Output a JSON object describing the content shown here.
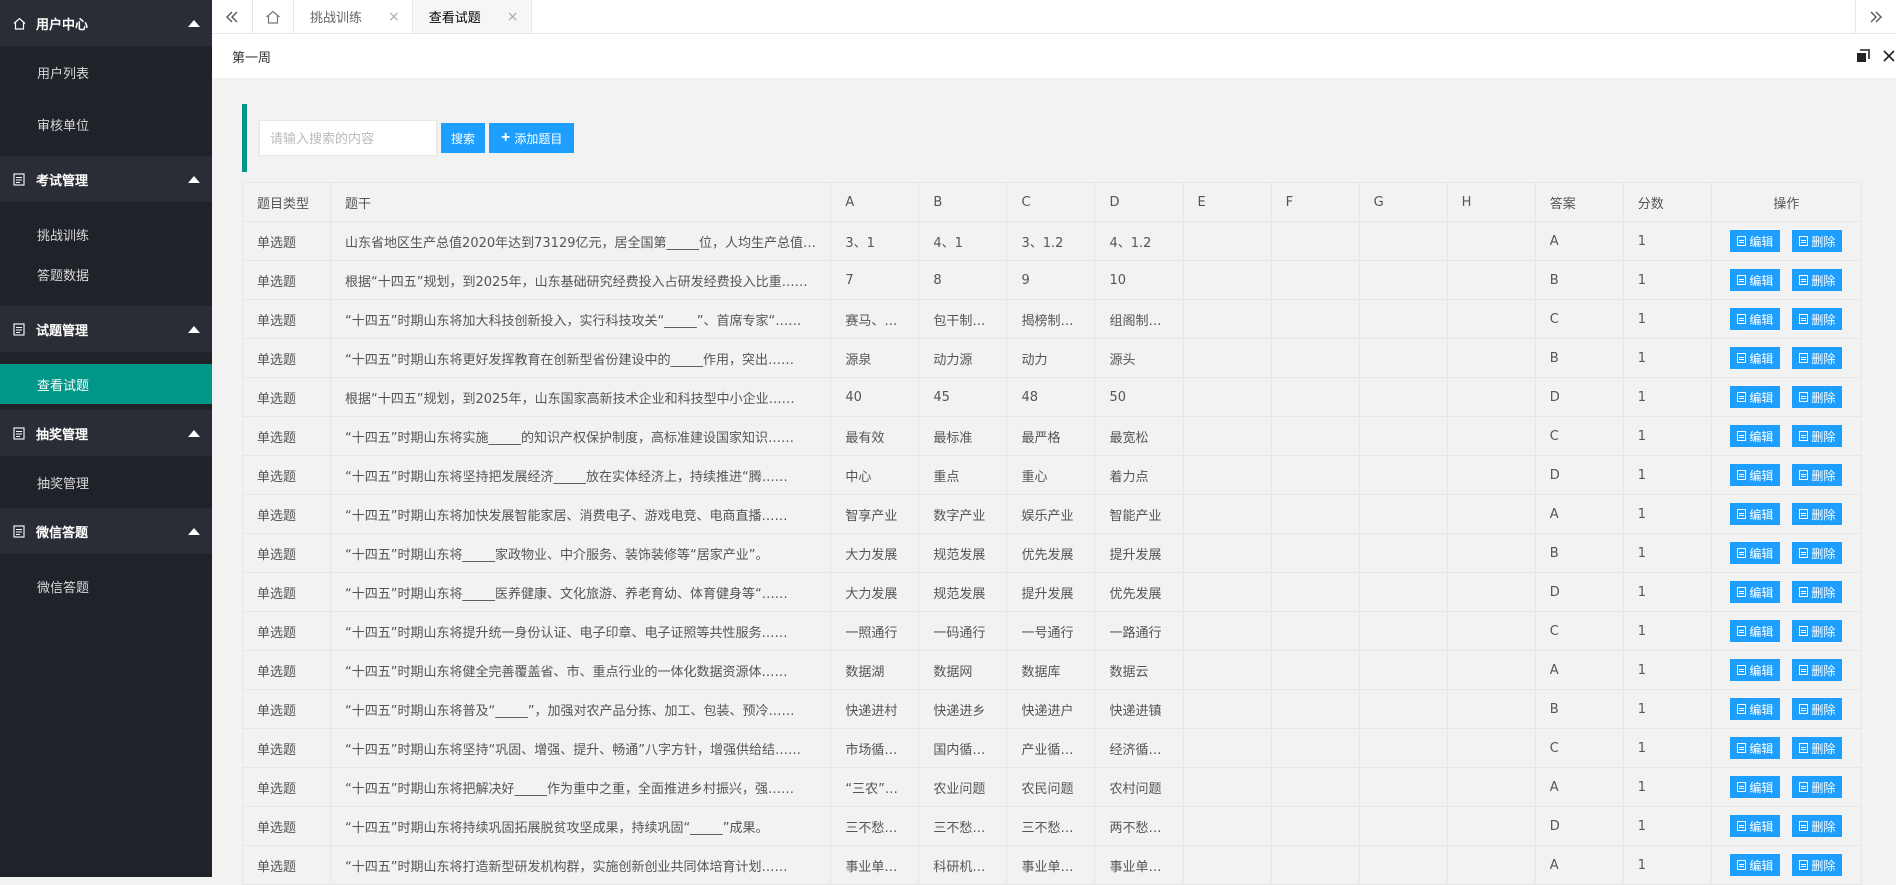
{
  "sidebar": {
    "groups": [
      {
        "title": "用户中心",
        "items": [
          "用户列表",
          "审核单位"
        ]
      },
      {
        "title": "考试管理",
        "items": [
          "挑战训练",
          "答题数据"
        ]
      },
      {
        "title": "试题管理",
        "items": [
          "查看试题"
        ]
      },
      {
        "title": "抽奖管理",
        "items": [
          "抽奖管理"
        ]
      },
      {
        "title": "微信答题",
        "items": [
          "微信答题"
        ]
      }
    ],
    "active_item": "查看试题"
  },
  "tabs": [
    {
      "label": "挑战训练",
      "close": "×"
    },
    {
      "label": "查看试题",
      "close": "×"
    }
  ],
  "breadcrumb": {
    "title": "第一周"
  },
  "search": {
    "placeholder": "请输入搜索的内容",
    "search_label": "搜索",
    "add_label": "添加题目",
    "add_icon": "+"
  },
  "table": {
    "headers": [
      "题目类型",
      "题干",
      "A",
      "B",
      "C",
      "D",
      "E",
      "F",
      "G",
      "H",
      "答案",
      "分数",
      "操作"
    ],
    "edit_label": "编辑",
    "delete_label": "删除",
    "rows": [
      {
        "type": "单选题",
        "stem": "山东省地区生产总值2020年达到73129亿元，居全国第_____位，人均生产总值达到……",
        "a": "3、1",
        "b": "4、1",
        "c": "3、1.2",
        "d": "4、1.2",
        "answer": "A",
        "score": "1"
      },
      {
        "type": "单选题",
        "stem": "根据“十四五”规划，到2025年，山东基础研究经费投入占研发经费投入比重……",
        "a": "7",
        "b": "8",
        "c": "9",
        "d": "10",
        "answer": "B",
        "score": "1"
      },
      {
        "type": "单选题",
        "stem": "“十四五”时期山东将加大科技创新投入，实行科技攻关“_____”、首席专家“……",
        "a": "赛马、…",
        "b": "包干制…",
        "c": "揭榜制…",
        "d": "组阁制…",
        "answer": "C",
        "score": "1"
      },
      {
        "type": "单选题",
        "stem": "“十四五”时期山东将更好发挥教育在创新型省份建设中的_____作用，突出……",
        "a": "源泉",
        "b": "动力源",
        "c": "动力",
        "d": "源头",
        "answer": "B",
        "score": "1"
      },
      {
        "type": "单选题",
        "stem": "根据“十四五”规划，到2025年，山东国家高新技术企业和科技型中小企业……",
        "a": "40",
        "b": "45",
        "c": "48",
        "d": "50",
        "answer": "D",
        "score": "1"
      },
      {
        "type": "单选题",
        "stem": "“十四五”时期山东将实施_____的知识产权保护制度，高标准建设国家知识……",
        "a": "最有效",
        "b": "最标准",
        "c": "最严格",
        "d": "最宽松",
        "answer": "C",
        "score": "1"
      },
      {
        "type": "单选题",
        "stem": "“十四五”时期山东将坚持把发展经济_____放在实体经济上，持续推进“腾……",
        "a": "中心",
        "b": "重点",
        "c": "重心",
        "d": "着力点",
        "answer": "D",
        "score": "1"
      },
      {
        "type": "单选题",
        "stem": "“十四五”时期山东将加快发展智能家居、消费电子、游戏电竞、电商直播……",
        "a": "智享产业",
        "b": "数字产业",
        "c": "娱乐产业",
        "d": "智能产业",
        "answer": "A",
        "score": "1"
      },
      {
        "type": "单选题",
        "stem": "“十四五”时期山东将_____家政物业、中介服务、装饰装修等“居家产业”。",
        "a": "大力发展",
        "b": "规范发展",
        "c": "优先发展",
        "d": "提升发展",
        "answer": "B",
        "score": "1"
      },
      {
        "type": "单选题",
        "stem": "“十四五”时期山东将_____医养健康、文化旅游、养老育幼、体育健身等“……",
        "a": "大力发展",
        "b": "规范发展",
        "c": "提升发展",
        "d": "优先发展",
        "answer": "D",
        "score": "1"
      },
      {
        "type": "单选题",
        "stem": "“十四五”时期山东将提升统一身份认证、电子印章、电子证照等共性服务……",
        "a": "一照通行",
        "b": "一码通行",
        "c": "一号通行",
        "d": "一路通行",
        "answer": "C",
        "score": "1"
      },
      {
        "type": "单选题",
        "stem": "“十四五”时期山东将健全完善覆盖省、市、重点行业的一体化数据资源体……",
        "a": "数据湖",
        "b": "数据网",
        "c": "数据库",
        "d": "数据云",
        "answer": "A",
        "score": "1"
      },
      {
        "type": "单选题",
        "stem": "“十四五”时期山东将普及“_____”，加强对农产品分拣、加工、包装、预冷……",
        "a": "快递进村",
        "b": "快递进乡",
        "c": "快递进户",
        "d": "快递进镇",
        "answer": "B",
        "score": "1"
      },
      {
        "type": "单选题",
        "stem": "“十四五”时期山东将坚持“巩固、增强、提升、畅通”八字方针，增强供给结……",
        "a": "市场循…",
        "b": "国内循…",
        "c": "产业循…",
        "d": "经济循…",
        "answer": "C",
        "score": "1"
      },
      {
        "type": "单选题",
        "stem": "“十四五”时期山东将把解决好_____作为重中之重，全面推进乡村振兴，强……",
        "a": "“三农”…",
        "b": "农业问题",
        "c": "农民问题",
        "d": "农村问题",
        "answer": "A",
        "score": "1"
      },
      {
        "type": "单选题",
        "stem": "“十四五”时期山东将持续巩固拓展脱贫攻坚成果，持续巩固“_____”成果。",
        "a": "三不愁…",
        "b": "三不愁…",
        "c": "三不愁…",
        "d": "两不愁…",
        "answer": "D",
        "score": "1"
      },
      {
        "type": "单选题",
        "stem": "“十四五”时期山东将打造新型研发机构群，实施创新创业共同体培育计划……",
        "a": "事业单…",
        "b": "科研机…",
        "c": "事业单…",
        "d": "事业单…",
        "answer": "A",
        "score": "1"
      }
    ]
  },
  "colors": {
    "sidebar_bg": "#20222a",
    "accent": "#009688",
    "button": "#1e9fff"
  }
}
